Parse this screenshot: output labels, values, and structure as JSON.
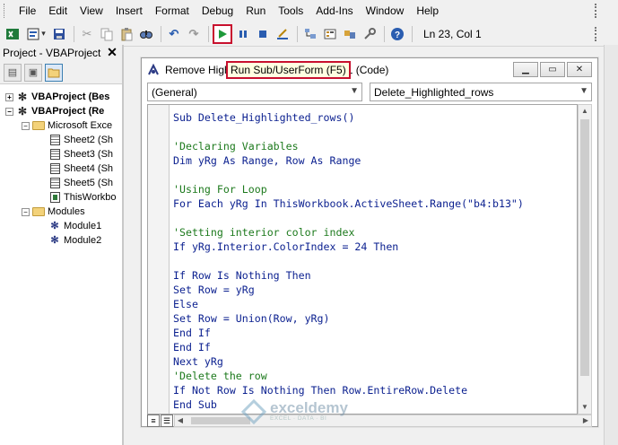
{
  "menubar": {
    "items": [
      "File",
      "Edit",
      "View",
      "Insert",
      "Format",
      "Debug",
      "Run",
      "Tools",
      "Add-Ins",
      "Window",
      "Help"
    ]
  },
  "toolbar": {
    "cursor_position": "Ln 23, Col 1",
    "icons": [
      "excel-icon",
      "insert-module-icon",
      "save-icon",
      "cut-icon",
      "copy-icon",
      "paste-icon",
      "find-icon",
      "undo-icon",
      "redo-icon",
      "run-icon",
      "break-icon",
      "reset-icon",
      "design-mode-icon",
      "project-explorer-icon",
      "properties-icon",
      "object-browser-icon",
      "toolbox-icon",
      "help-icon"
    ]
  },
  "project_pane": {
    "title": "Project - VBAProject",
    "close_glyph": "✕",
    "tree": [
      {
        "label": "VBAProject (Bes",
        "bold": true,
        "expander": "+",
        "level": 0,
        "icon": "vba-project-icon"
      },
      {
        "label": "VBAProject (Re",
        "bold": true,
        "expander": "−",
        "level": 0,
        "icon": "vba-project-icon"
      },
      {
        "label": "Microsoft Exce",
        "bold": false,
        "expander": "−",
        "level": 1,
        "icon": "folder-icon"
      },
      {
        "label": "Sheet2 (Sh",
        "bold": false,
        "expander": "",
        "level": 2,
        "icon": "sheet-icon"
      },
      {
        "label": "Sheet3 (Sh",
        "bold": false,
        "expander": "",
        "level": 2,
        "icon": "sheet-icon"
      },
      {
        "label": "Sheet4 (Sh",
        "bold": false,
        "expander": "",
        "level": 2,
        "icon": "sheet-icon"
      },
      {
        "label": "Sheet5 (Sh",
        "bold": false,
        "expander": "",
        "level": 2,
        "icon": "sheet-icon"
      },
      {
        "label": "ThisWorkbo",
        "bold": false,
        "expander": "",
        "level": 2,
        "icon": "workbook-icon"
      },
      {
        "label": "Modules",
        "bold": false,
        "expander": "−",
        "level": 1,
        "icon": "folder-icon"
      },
      {
        "label": "Module1",
        "bold": false,
        "expander": "",
        "level": 2,
        "icon": "module-icon"
      },
      {
        "label": "Module2",
        "bold": false,
        "expander": "",
        "level": 2,
        "icon": "module-icon"
      }
    ]
  },
  "code_window": {
    "title_prefix": "Remove High",
    "title_suffix": "ule1 (Code)",
    "tooltip": "Run Sub/UserForm (F5)",
    "object_combo": "(General)",
    "procedure_combo": "Delete_Highlighted_rows",
    "lines": [
      {
        "text": "Sub Delete_Highlighted_rows()",
        "style": "kw"
      },
      {
        "text": "",
        "style": ""
      },
      {
        "text": "'Declaring Variables",
        "style": "cm"
      },
      {
        "text": "Dim yRg As Range, Row As Range",
        "style": "kw"
      },
      {
        "text": "",
        "style": ""
      },
      {
        "text": "'Using For Loop",
        "style": "cm"
      },
      {
        "text": "For Each yRg In ThisWorkbook.ActiveSheet.Range(\"b4:b13\")",
        "style": "kw"
      },
      {
        "text": "",
        "style": ""
      },
      {
        "text": "'Setting interior color index",
        "style": "cm"
      },
      {
        "text": "If yRg.Interior.ColorIndex = 24 Then",
        "style": "kw"
      },
      {
        "text": "",
        "style": ""
      },
      {
        "text": "If Row Is Nothing Then",
        "style": "kw"
      },
      {
        "text": "Set Row = yRg",
        "style": "kw"
      },
      {
        "text": "Else",
        "style": "kw"
      },
      {
        "text": "Set Row = Union(Row, yRg)",
        "style": "kw"
      },
      {
        "text": "End If",
        "style": "kw"
      },
      {
        "text": "End If",
        "style": "kw"
      },
      {
        "text": "Next yRg",
        "style": "kw"
      },
      {
        "text": "'Delete the row",
        "style": "cm"
      },
      {
        "text": "If Not Row Is Nothing Then Row.EntireRow.Delete",
        "style": "kw"
      },
      {
        "text": "End Sub",
        "style": "kw"
      }
    ]
  },
  "watermark": {
    "name": "exceldemy",
    "tagline": "EXCEL · DATA · BI"
  },
  "colors": {
    "highlight_border": "#c8102e",
    "keyword": "#0a1f8f",
    "comment": "#1d7a1d",
    "tooltip_bg": "#ffffe1"
  }
}
